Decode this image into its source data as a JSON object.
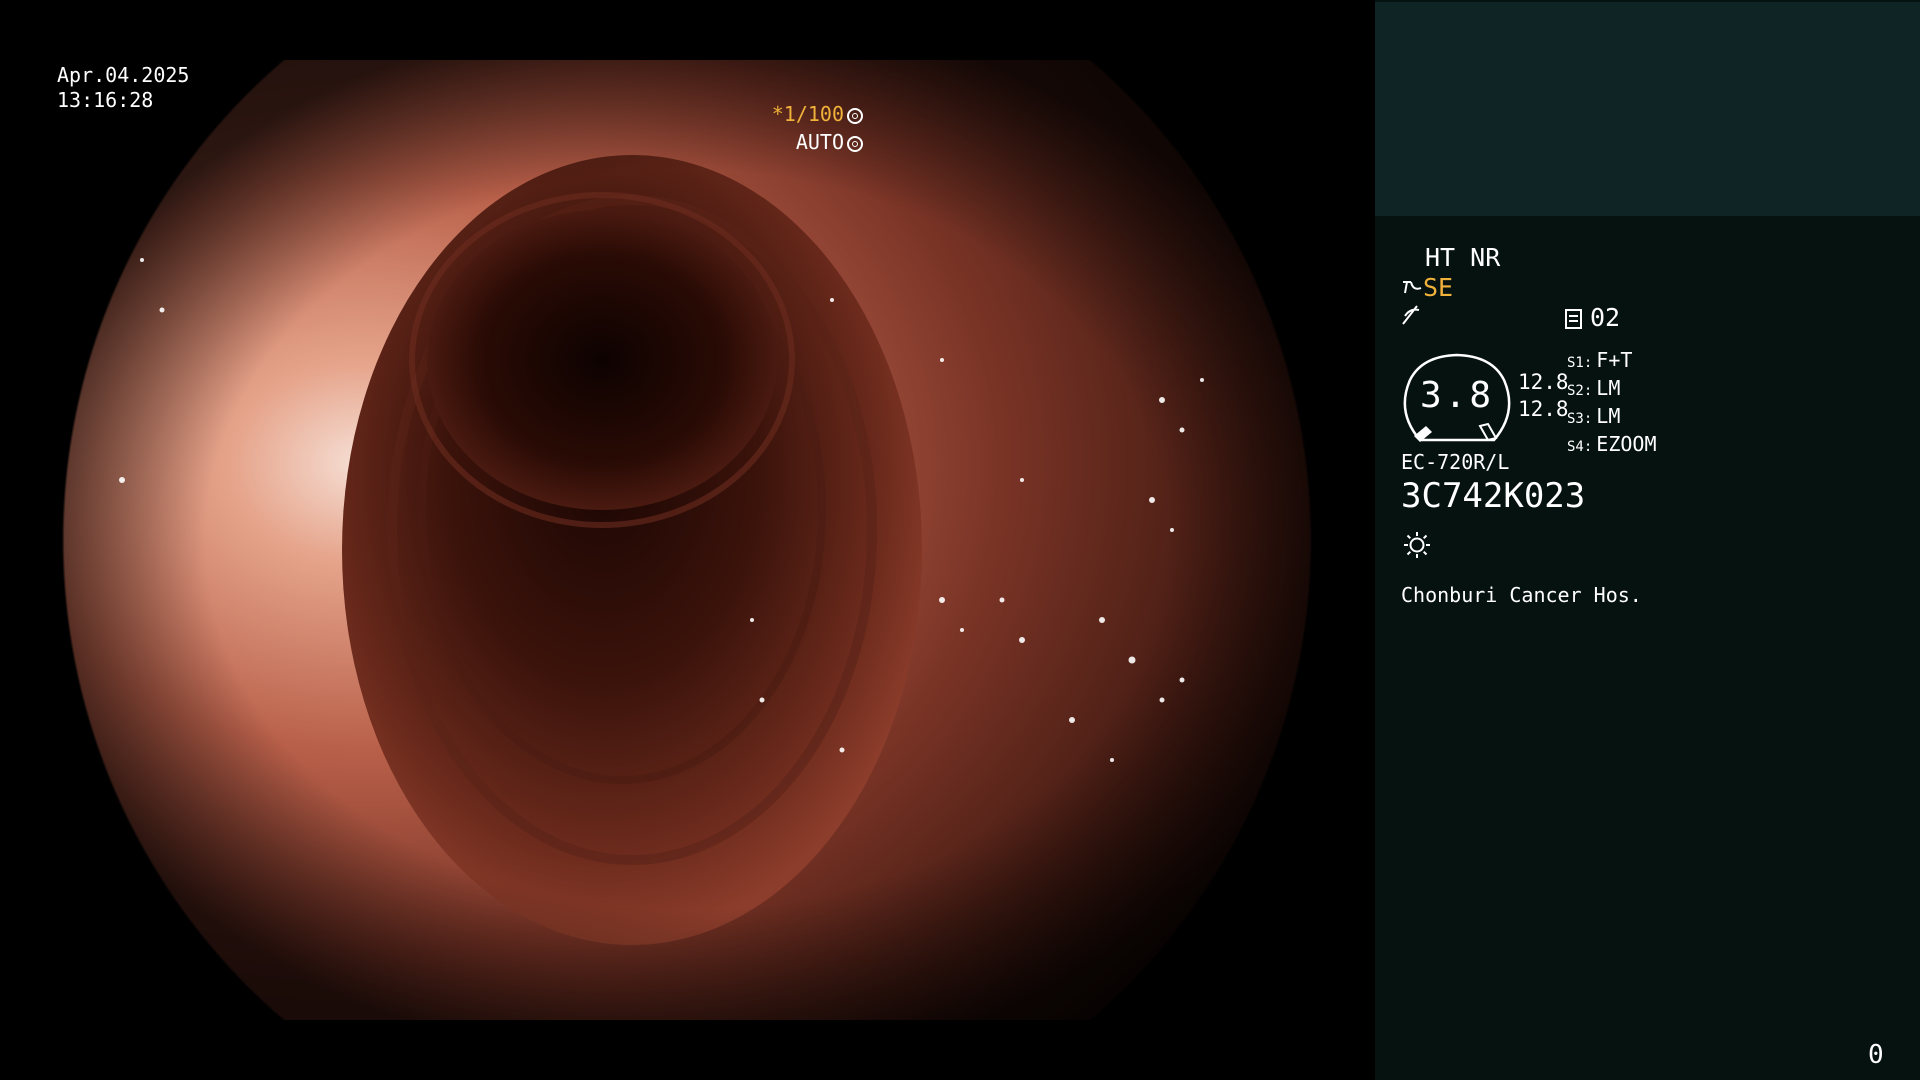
{
  "app": "Endoscopy video processor display",
  "osd": {
    "date": "Apr.04.2025",
    "time": "13:16:28",
    "shutter_speed": "*1/100",
    "exposure_mode": "AUTO"
  },
  "panel": {
    "enhancement": "HT NR",
    "structure_enhancement": "SE",
    "image_preset_number": "02",
    "zoom_value": "3.8",
    "pressure_1": "12.8",
    "pressure_2": "12.8",
    "switches": [
      {
        "key": "S1:",
        "value": "F+T"
      },
      {
        "key": "S2:",
        "value": "LM"
      },
      {
        "key": "S3:",
        "value": "LM"
      },
      {
        "key": "S4:",
        "value": "EZOOM"
      }
    ],
    "scope_model": "EC-720R/L",
    "scope_serial": "3C742K023",
    "hospital": "Chonburi Cancer Hos."
  },
  "frame_counter": "0",
  "icons": {
    "shutter": "aperture-icon",
    "auto": "iris-icon",
    "se": "structure-enhance-icon",
    "dl": "color-mode-icon",
    "preset": "preset-memory-icon",
    "lamp": "light-source-icon"
  },
  "colors": {
    "panel_bg": "#061210",
    "panel_top_bg": "#0e2425",
    "highlight": "#f0b23a"
  }
}
